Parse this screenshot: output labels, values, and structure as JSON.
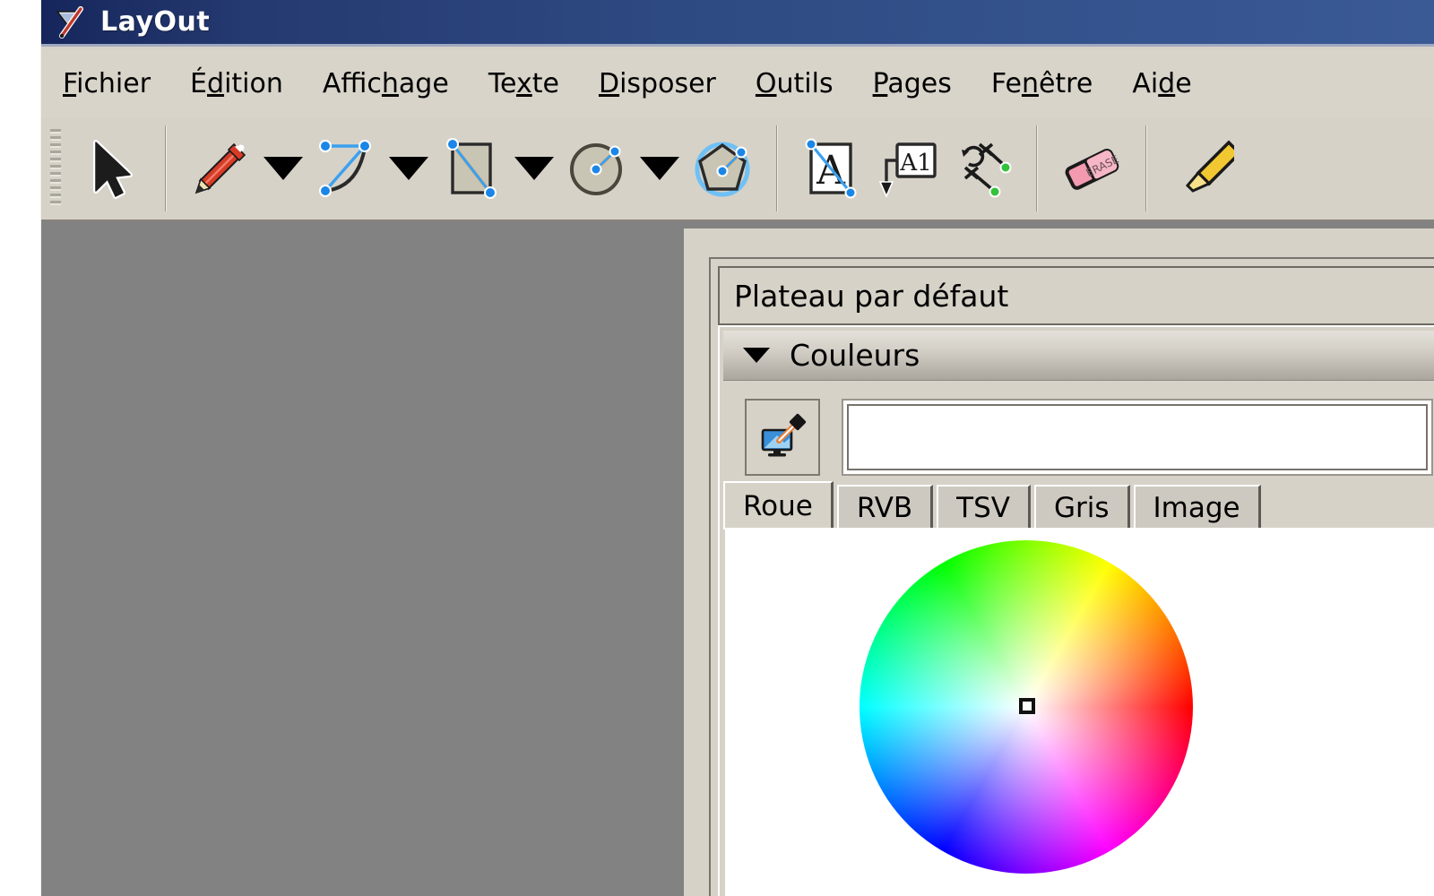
{
  "window": {
    "title": "LayOut",
    "logo_icon": "layout-logo-icon",
    "titlebar_color_start": "#16265c",
    "titlebar_color_end": "#3a5a96",
    "chrome_color": "#d6d2c8",
    "canvas_color": "#828282"
  },
  "menubar": {
    "items": [
      {
        "label": "Fichier",
        "mnemonic": "F"
      },
      {
        "label": "Édition",
        "mnemonic": "d"
      },
      {
        "label": "Affichage",
        "mnemonic": "h"
      },
      {
        "label": "Texte",
        "mnemonic": "x"
      },
      {
        "label": "Disposer",
        "mnemonic": "D"
      },
      {
        "label": "Outils",
        "mnemonic": "O"
      },
      {
        "label": "Pages",
        "mnemonic": "P"
      },
      {
        "label": "Fenêtre",
        "mnemonic": "n"
      },
      {
        "label": "Aide",
        "mnemonic": "d"
      }
    ]
  },
  "toolbar": {
    "grip_icon": "toolbar-grip-icon",
    "tools": [
      {
        "name": "select-tool",
        "icon": "arrow-cursor-icon"
      },
      {
        "name": "line-tool",
        "icon": "pencil-icon"
      },
      {
        "name": "line-tool-dropdown",
        "icon": "chevron-down-icon"
      },
      {
        "name": "arc-tool",
        "icon": "arc-curve-icon"
      },
      {
        "name": "arc-tool-dropdown",
        "icon": "chevron-down-icon"
      },
      {
        "name": "rectangle-tool",
        "icon": "rectangle-icon"
      },
      {
        "name": "rectangle-tool-dropdown",
        "icon": "chevron-down-icon"
      },
      {
        "name": "circle-tool",
        "icon": "circle-icon"
      },
      {
        "name": "circle-tool-dropdown",
        "icon": "chevron-down-icon"
      },
      {
        "name": "polygon-tool",
        "icon": "polygon-icon"
      },
      {
        "name": "text-tool",
        "icon": "text-box-a-icon"
      },
      {
        "name": "label-tool",
        "icon": "label-a1-icon"
      },
      {
        "name": "dimension-tool",
        "icon": "dimension-icon"
      },
      {
        "name": "eraser-tool",
        "icon": "eraser-icon"
      },
      {
        "name": "highlighter-tool",
        "icon": "highlighter-icon"
      }
    ]
  },
  "inspector": {
    "tray_title": "Plateau par défaut",
    "section": {
      "label": "Couleurs",
      "expanded": true,
      "collapse_icon": "triangle-down-icon"
    },
    "picker": {
      "eyedropper_icon": "eyedropper-monitor-icon",
      "swatch_value": "#ffffff"
    },
    "tabs": [
      {
        "label": "Roue",
        "active": true
      },
      {
        "label": "RVB",
        "active": false
      },
      {
        "label": "TSV",
        "active": false
      },
      {
        "label": "Gris",
        "active": false
      },
      {
        "label": "Image",
        "active": false
      }
    ],
    "wheel": {
      "icon": "color-wheel-icon",
      "cursor_icon": "wheel-cursor-icon",
      "selected_color": "#ffffff"
    }
  }
}
